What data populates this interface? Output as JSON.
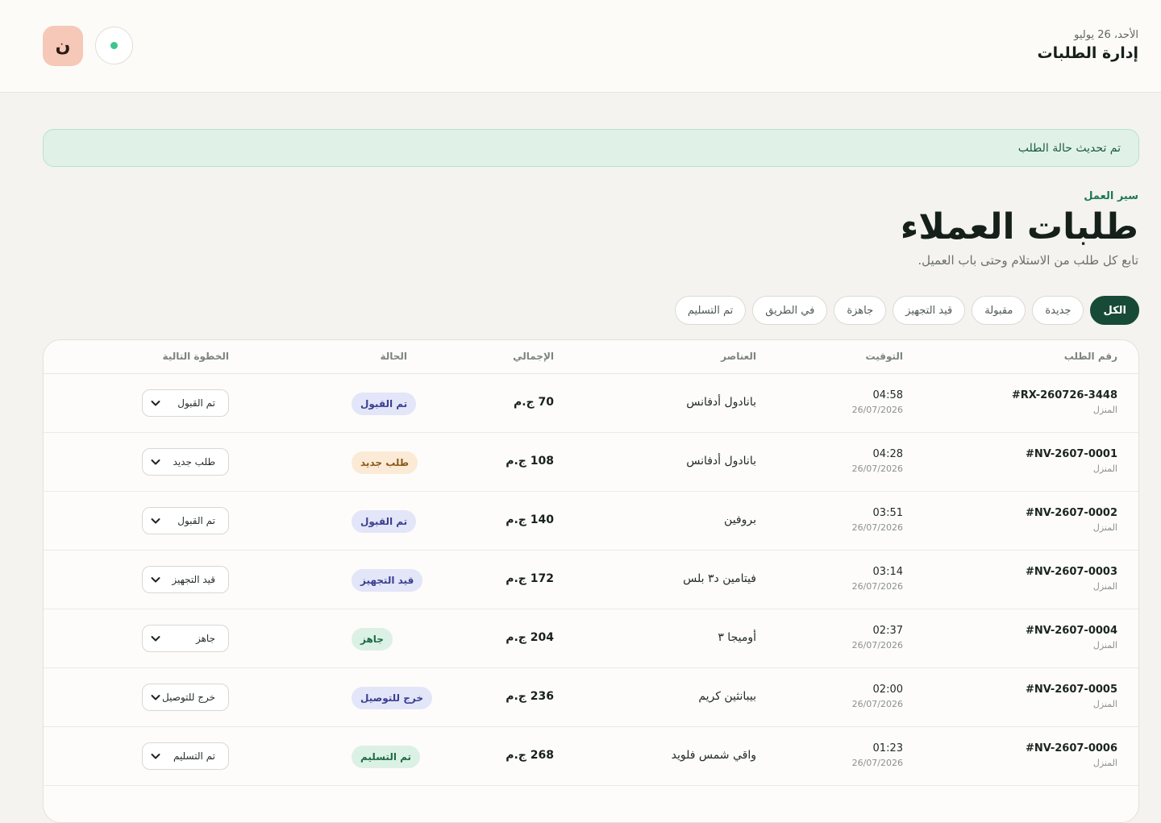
{
  "header": {
    "date": "الأحد، 26 يوليو",
    "title": "إدارة الطلبات",
    "avatar_initial": "ن",
    "status_color": "#3ec48e"
  },
  "alert": {
    "message": "تم تحديث حالة الطلب"
  },
  "page": {
    "eyebrow": "سير العمل",
    "title": "طلبات العملاء",
    "subtitle": "تابع كل طلب من الاستلام وحتى باب العميل."
  },
  "filters": [
    "الكل",
    "جديدة",
    "مقبولة",
    "قيد التجهيز",
    "جاهزة",
    "في الطريق",
    "تم التسليم"
  ],
  "active_filter": "الكل",
  "table": {
    "headers": {
      "order": "رقم الطلب",
      "time": "التوقيت",
      "items": "العناصر",
      "total": "الإجمالي",
      "status": "الحالة",
      "next": "الخطوة التالية"
    },
    "rows": [
      {
        "order": "#RX-260726-3448",
        "type": "المنزل",
        "time": "04:58",
        "date": "26/07/2026",
        "items": "بانادول أدفانس",
        "total": "70 ج.م",
        "status": "تم القبول",
        "next": "تم القبول",
        "status_bg": "#e3e5f8",
        "status_fg": "#3a3f8f"
      },
      {
        "order": "#NV-2607-0001",
        "type": "المنزل",
        "time": "04:28",
        "date": "26/07/2026",
        "items": "بانادول أدفانس",
        "total": "108 ج.م",
        "status": "طلب جديد",
        "next": "طلب جديد",
        "status_bg": "#fbead5",
        "status_fg": "#8a5a1d"
      },
      {
        "order": "#NV-2607-0002",
        "type": "المنزل",
        "time": "03:51",
        "date": "26/07/2026",
        "items": "بروفين",
        "total": "140 ج.م",
        "status": "تم القبول",
        "next": "تم القبول",
        "status_bg": "#e3e5f8",
        "status_fg": "#3a3f8f"
      },
      {
        "order": "#NV-2607-0003",
        "type": "المنزل",
        "time": "03:14",
        "date": "26/07/2026",
        "items": "فيتامين د٣ بلس",
        "total": "172 ج.م",
        "status": "قيد التجهيز",
        "next": "قيد التجهيز",
        "status_bg": "#e3e5f8",
        "status_fg": "#3a3f8f"
      },
      {
        "order": "#NV-2607-0004",
        "type": "المنزل",
        "time": "02:37",
        "date": "26/07/2026",
        "items": "أوميجا ٣",
        "total": "204 ج.م",
        "status": "جاهز",
        "next": "جاهز",
        "status_bg": "#dcf1e5",
        "status_fg": "#1f6b45"
      },
      {
        "order": "#NV-2607-0005",
        "type": "المنزل",
        "time": "02:00",
        "date": "26/07/2026",
        "items": "بيبانثين كريم",
        "total": "236 ج.م",
        "status": "خرج للتوصيل",
        "next": "خرج للتوصيل",
        "status_bg": "#e3e5f8",
        "status_fg": "#3a3f8f"
      },
      {
        "order": "#NV-2607-0006",
        "type": "المنزل",
        "time": "01:23",
        "date": "26/07/2026",
        "items": "واقي شمس فلويد",
        "total": "268 ج.م",
        "status": "تم التسليم",
        "next": "تم التسليم",
        "status_bg": "#dcf1e5",
        "status_fg": "#1f6b45"
      }
    ]
  }
}
